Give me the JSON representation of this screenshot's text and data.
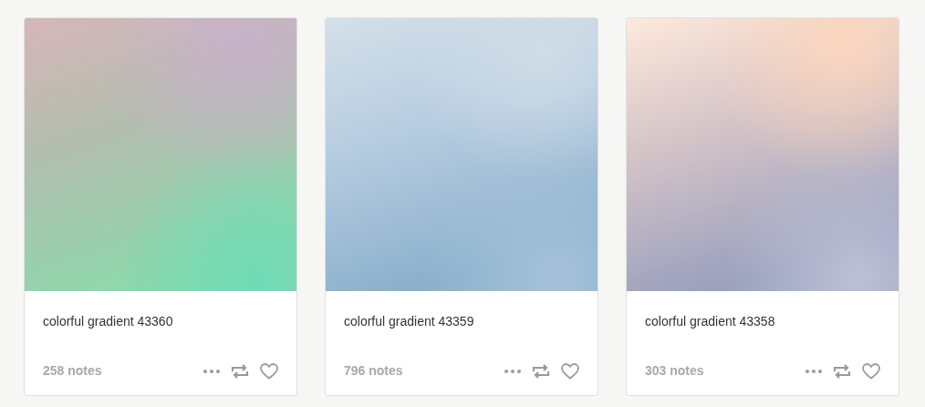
{
  "posts": [
    {
      "title": "colorful gradient 43360",
      "notes": "258 notes"
    },
    {
      "title": "colorful gradient 43359",
      "notes": "796 notes"
    },
    {
      "title": "colorful gradient 43358",
      "notes": "303 notes"
    }
  ]
}
